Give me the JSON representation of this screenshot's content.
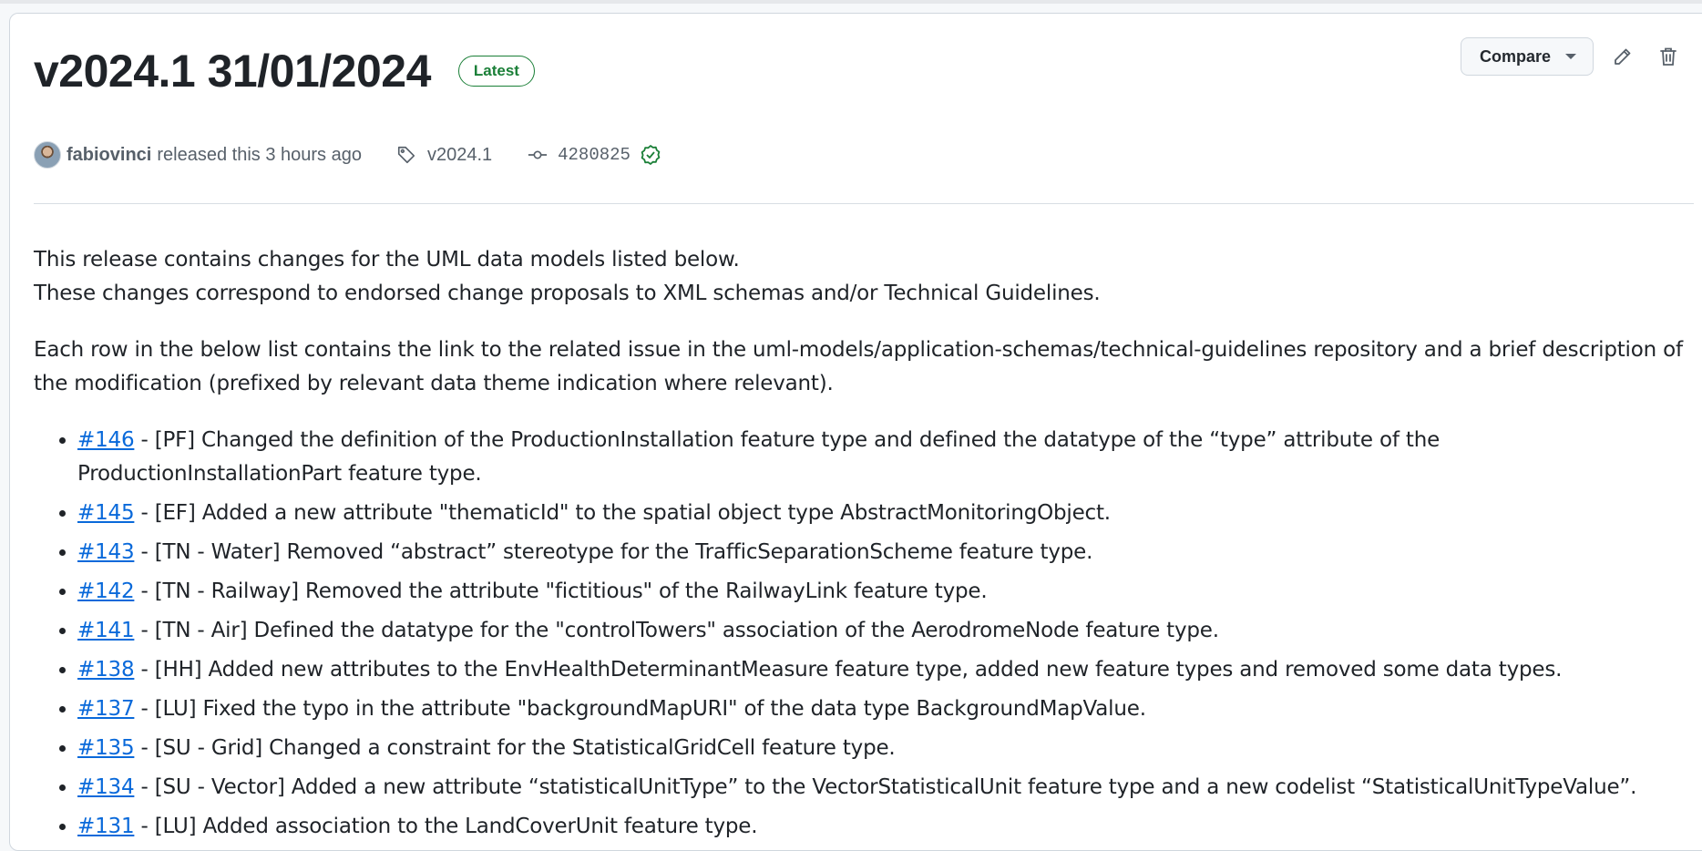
{
  "release": {
    "title": "v2024.1 31/01/2024",
    "badge": "Latest"
  },
  "actions": {
    "compare_label": "Compare",
    "edit_icon": "pencil-icon",
    "delete_icon": "trash-icon"
  },
  "meta": {
    "author": "fabiovinci",
    "released_text": "released this 3 hours ago",
    "tag": "v2024.1",
    "commit": "4280825",
    "tag_icon": "tag-icon",
    "commit_icon": "git-commit-icon",
    "verified_icon": "verified-check-icon"
  },
  "body": {
    "line1": "This release contains changes for the UML data models listed below.",
    "line2": "These changes correspond to endorsed change proposals to XML schemas and/or Technical Guidelines.",
    "para2": "Each row in the below list contains the link to the related issue in the uml-models/application-schemas/technical-guidelines repository and a brief description of the modification (prefixed by relevant data theme indication where relevant).",
    "changes": [
      {
        "issue": "#146",
        "text": " - [PF] Changed the definition of the ProductionInstallation feature type and defined the datatype of the “type” attribute of the ProductionInstallationPart feature type."
      },
      {
        "issue": "#145",
        "text": " - [EF] Added a new attribute \"thematicId\" to the spatial object type AbstractMonitoringObject."
      },
      {
        "issue": "#143",
        "text": " - [TN - Water] Removed “abstract” stereotype for the TrafficSeparationScheme feature type."
      },
      {
        "issue": "#142",
        "text": " - [TN - Railway] Removed the attribute \"fictitious\" of the RailwayLink feature type."
      },
      {
        "issue": "#141",
        "text": " - [TN - Air] Defined the datatype for the \"controlTowers\" association of the AerodromeNode feature type."
      },
      {
        "issue": "#138",
        "text": " - [HH] Added new attributes to the EnvHealthDeterminantMeasure feature type, added new feature types and removed some data types."
      },
      {
        "issue": "#137",
        "text": " - [LU] Fixed the typo in the attribute \"backgroundMapURI\" of the data type BackgroundMapValue."
      },
      {
        "issue": "#135",
        "text": " - [SU - Grid] Changed a constraint for the StatisticalGridCell feature type."
      },
      {
        "issue": "#134",
        "text": " - [SU - Vector] Added a new attribute “statisticalUnitType” to the VectorStatisticalUnit feature type and a new codelist “StatisticalUnitTypeValue”."
      },
      {
        "issue": "#131",
        "text": " - [LU] Added association to the LandCoverUnit feature type."
      }
    ]
  },
  "colors": {
    "link": "#0969da",
    "badge_green": "#1a7f37",
    "muted": "#57606a"
  }
}
